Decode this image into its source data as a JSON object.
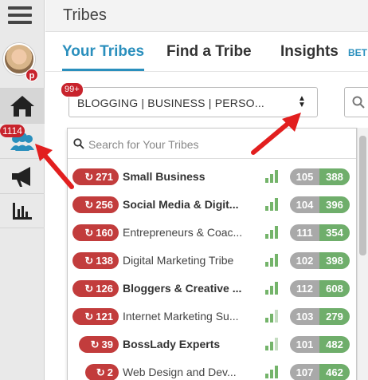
{
  "header": {
    "title": "Tribes"
  },
  "tabs": [
    {
      "label": "Your Tribes"
    },
    {
      "label": "Find a Tribe"
    },
    {
      "label": "Insights"
    }
  ],
  "beta_label": "BET",
  "sidebar": {
    "pinterest_badge": "p",
    "tribes_count": "1114",
    "icons": [
      "menu-icon",
      "home-icon",
      "tribes-icon",
      "megaphone-icon",
      "bar-chart-icon"
    ]
  },
  "selector": {
    "value": "BLOGGING | BUSINESS | PERSO...",
    "badge": "99+"
  },
  "search": {
    "placeholder": "Search for Your Tribes"
  },
  "tribes": [
    {
      "count": "271",
      "name": "Small Business",
      "bold": true,
      "stat_a": "105",
      "stat_b": "388",
      "level": 3
    },
    {
      "count": "256",
      "name": "Social Media & Digit...",
      "bold": true,
      "stat_a": "104",
      "stat_b": "396",
      "level": 3
    },
    {
      "count": "160",
      "name": "Entrepreneurs & Coac...",
      "bold": false,
      "stat_a": "111",
      "stat_b": "354",
      "level": 3
    },
    {
      "count": "138",
      "name": "Digital Marketing Tribe",
      "bold": false,
      "stat_a": "102",
      "stat_b": "398",
      "level": 3
    },
    {
      "count": "126",
      "name": "Bloggers & Creative ...",
      "bold": true,
      "stat_a": "112",
      "stat_b": "608",
      "level": 3
    },
    {
      "count": "121",
      "name": "Internet Marketing Su...",
      "bold": false,
      "stat_a": "103",
      "stat_b": "279",
      "level": 2
    },
    {
      "count": "39",
      "name": "BossLady Experts",
      "bold": true,
      "stat_a": "101",
      "stat_b": "482",
      "level": 2
    },
    {
      "count": "2",
      "name": "Web Design and Dev...",
      "bold": false,
      "stat_a": "107",
      "stat_b": "462",
      "level": 3
    }
  ],
  "colors": {
    "accent": "#2a8fbd",
    "badge_red": "#c8232c",
    "pill_red": "#c23c3c",
    "green": "#6fae6b",
    "grey": "#a9a9a9",
    "arrow_red": "#e21f1f"
  }
}
